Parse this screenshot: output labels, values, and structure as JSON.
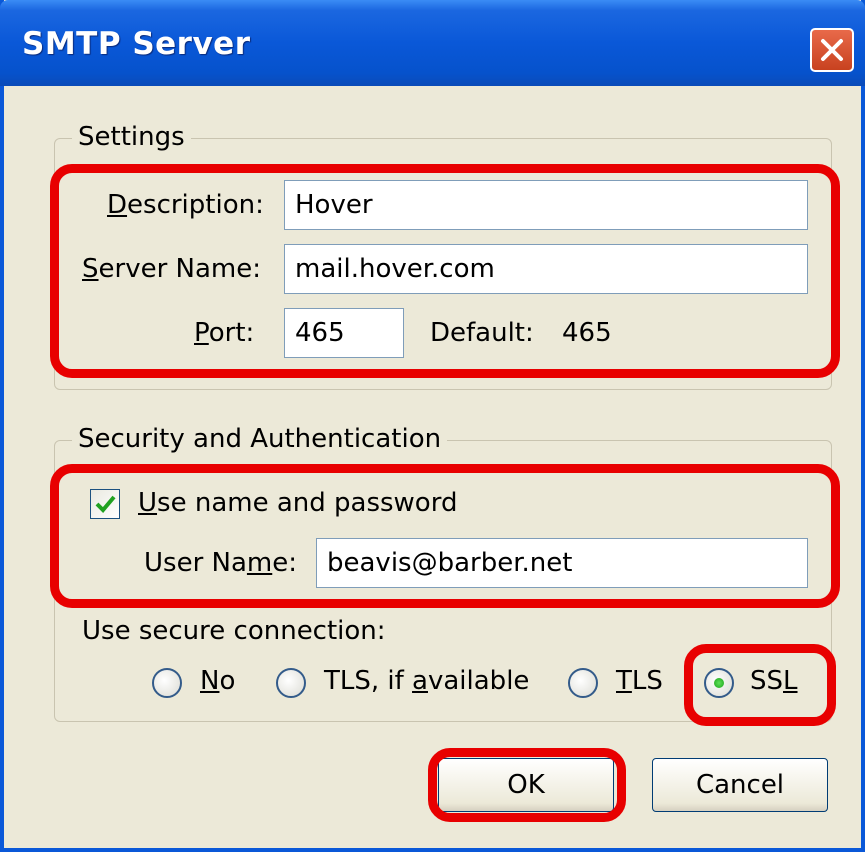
{
  "window": {
    "title": "SMTP Server"
  },
  "settings": {
    "legend": "Settings",
    "description_label_pre": "",
    "description_label_ul": "D",
    "description_label_post": "escription:",
    "description_value": "Hover",
    "server_label_ul": "S",
    "server_label_post": "erver Name:",
    "server_value": "mail.hover.com",
    "port_label_ul": "P",
    "port_label_post": "ort:",
    "port_value": "465",
    "default_label": "Default:",
    "default_value": "465"
  },
  "security": {
    "legend": "Security and Authentication",
    "use_name_ul": "U",
    "use_name_post": "se name and password",
    "use_name_checked": true,
    "username_label_pre": "User Na",
    "username_label_ul": "m",
    "username_label_post": "e:",
    "username_value": "beavis@barber.net",
    "secure_label": "Use secure connection:",
    "radio_no_ul": "N",
    "radio_no_post": "o",
    "radio_tls_avail_pre": "TLS, if ",
    "radio_tls_avail_ul": "a",
    "radio_tls_avail_post": "vailable",
    "radio_tls_ul": "T",
    "radio_tls_post": "LS",
    "radio_ssl_pre": "SS",
    "radio_ssl_ul": "L",
    "selected": "SSL"
  },
  "buttons": {
    "ok": "OK",
    "cancel": "Cancel"
  },
  "colors": {
    "highlight": "#e80000",
    "title_blue": "#0a58d8",
    "background": "#ece9d8"
  }
}
